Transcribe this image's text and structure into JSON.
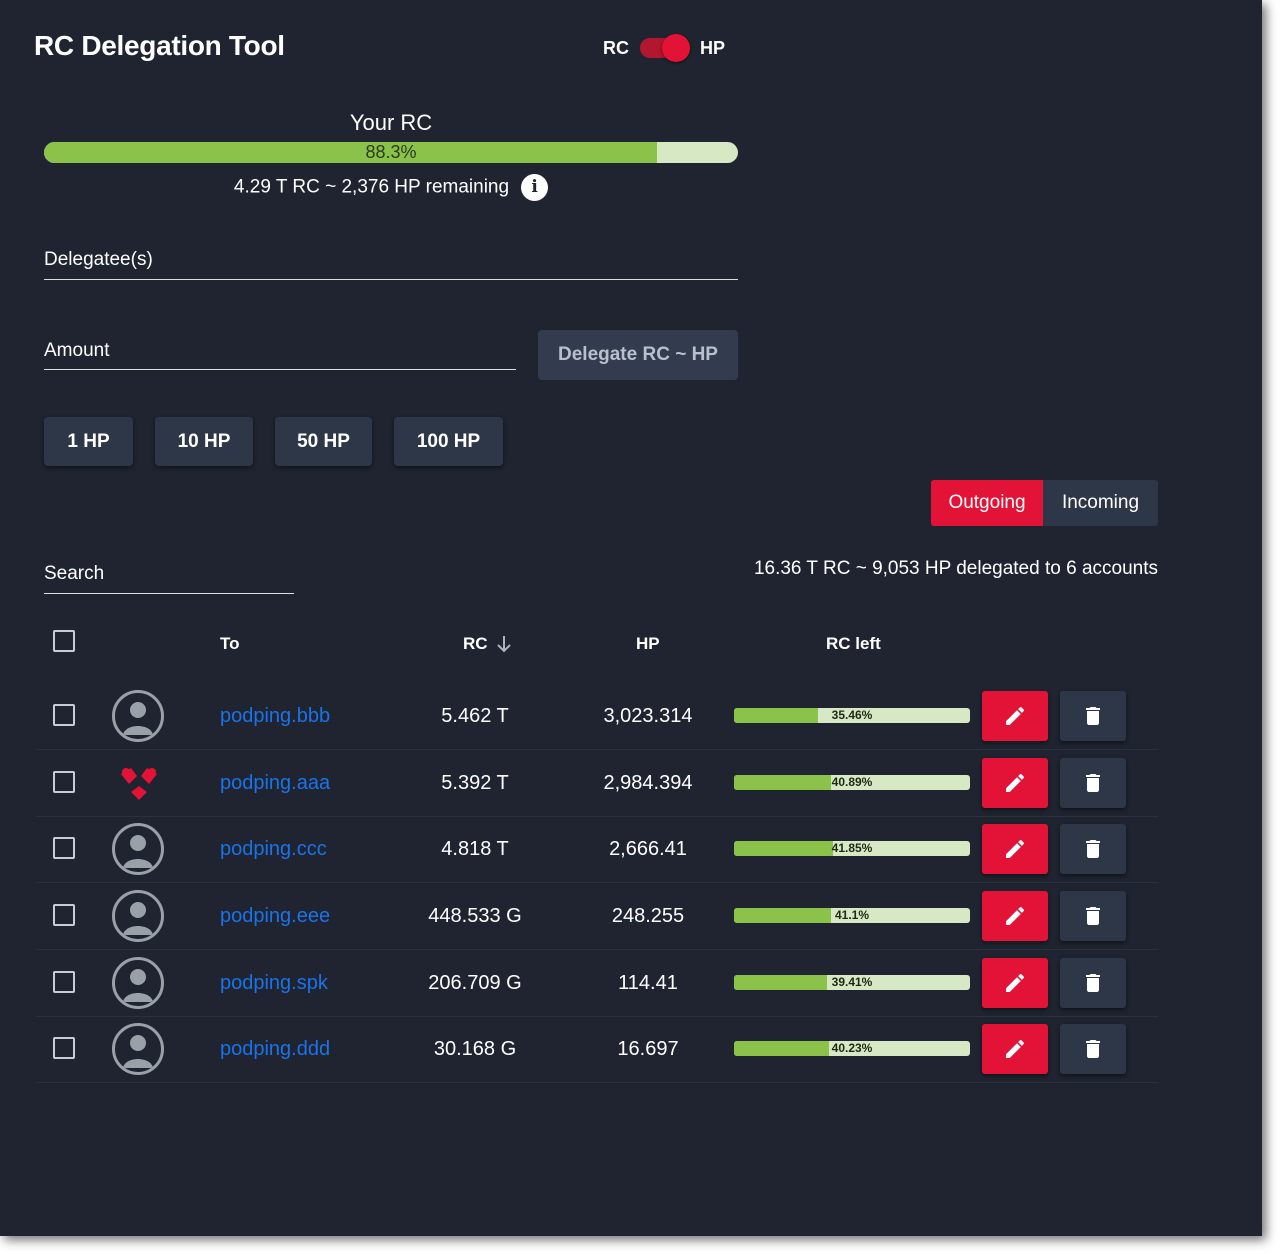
{
  "app": {
    "title": "RC Delegation Tool"
  },
  "toggle": {
    "left_label": "RC",
    "right_label": "HP",
    "state": "HP"
  },
  "your_rc": {
    "title": "Your RC",
    "percent": 88.3,
    "percent_label": "88.3%",
    "remaining": "4.29 T RC ~ 2,376 HP remaining"
  },
  "form": {
    "delegatees_label": "Delegatee(s)",
    "amount_label": "Amount",
    "delegate_button": "Delegate RC ~ HP",
    "quick_amounts": [
      "1 HP",
      "10 HP",
      "50 HP",
      "100 HP"
    ]
  },
  "tabs": {
    "outgoing": "Outgoing",
    "incoming": "Incoming",
    "active": "Outgoing"
  },
  "search": {
    "label": "Search"
  },
  "summary": "16.36 T RC ~ 9,053 HP delegated to 6 accounts",
  "table": {
    "headers": {
      "to": "To",
      "rc": "RC",
      "hp": "HP",
      "rc_left": "RC left"
    },
    "rows": [
      {
        "name": "podping.bbb",
        "avatar": "default-user-icon",
        "rc": "5.462 T",
        "hp": "3,023.314",
        "rc_left": 35.46,
        "rc_left_label": "35.46%"
      },
      {
        "name": "podping.aaa",
        "avatar": "podping-logo-icon",
        "rc": "5.392 T",
        "hp": "2,984.394",
        "rc_left": 40.89,
        "rc_left_label": "40.89%"
      },
      {
        "name": "podping.ccc",
        "avatar": "default-user-icon",
        "rc": "4.818 T",
        "hp": "2,666.41",
        "rc_left": 41.85,
        "rc_left_label": "41.85%"
      },
      {
        "name": "podping.eee",
        "avatar": "default-user-icon",
        "rc": "448.533 G",
        "hp": "248.255",
        "rc_left": 41.1,
        "rc_left_label": "41.1%"
      },
      {
        "name": "podping.spk",
        "avatar": "default-user-icon",
        "rc": "206.709 G",
        "hp": "114.41",
        "rc_left": 39.41,
        "rc_left_label": "39.41%"
      },
      {
        "name": "podping.ddd",
        "avatar": "default-user-icon",
        "rc": "30.168 G",
        "hp": "16.697",
        "rc_left": 40.23,
        "rc_left_label": "40.23%"
      }
    ]
  },
  "colors": {
    "background": "#1f2430",
    "accent_red": "#e31337",
    "progress_green": "#8bc34a",
    "progress_track": "#d6e8c4",
    "link_blue": "#1a73e8",
    "button_dark": "#2e3748"
  }
}
